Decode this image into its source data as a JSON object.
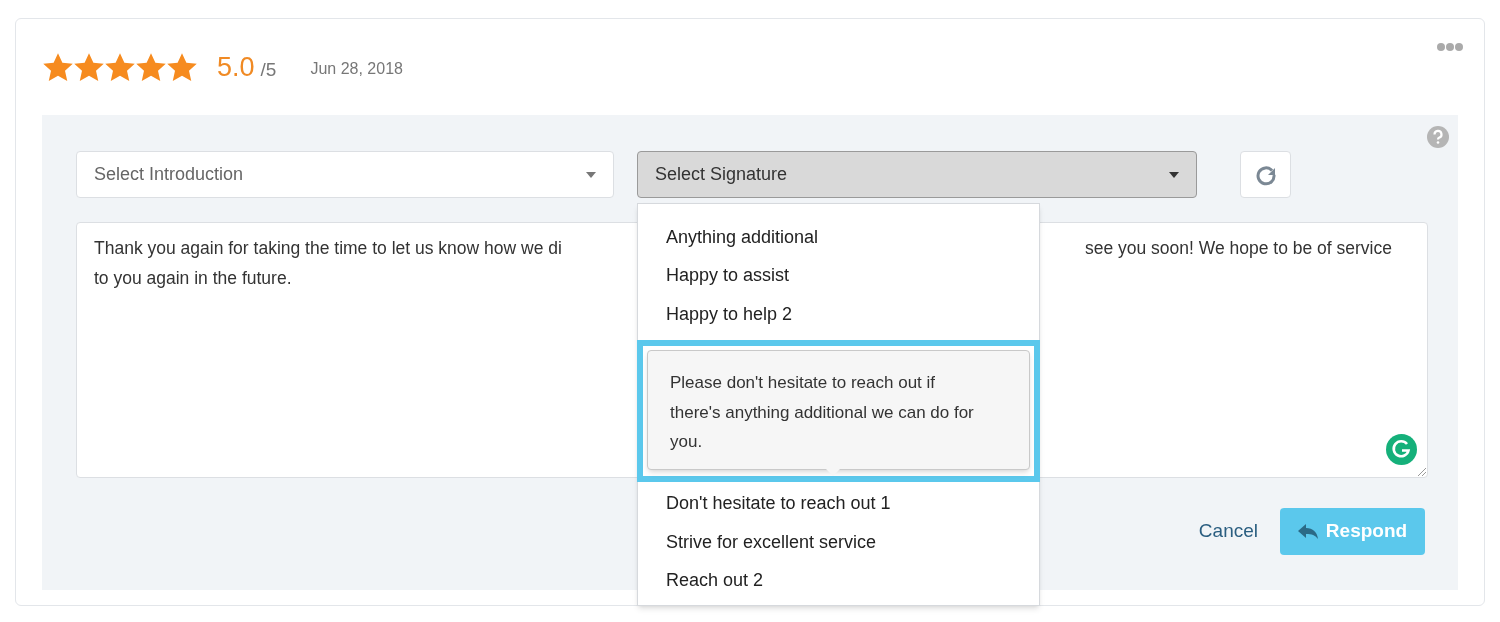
{
  "review": {
    "stars": 5,
    "score": "5.0",
    "out_of": "/5",
    "date": "Jun 28, 2018"
  },
  "introduction_select": {
    "placeholder": "Select Introduction"
  },
  "signature_select": {
    "value": "Select Signature",
    "expanded": true
  },
  "response_text": {
    "line_1_left": "Thank you again for taking the time to let us know how we di",
    "line_1_right": "see you soon! We hope to be of service",
    "line_2": "to you again in the future."
  },
  "signature_options_above_tooltip": [
    {
      "label": "Anything additional",
      "selected": false
    },
    {
      "label": "Happy to assist",
      "selected": false
    },
    {
      "label": "Happy to help 2",
      "selected": false
    }
  ],
  "signature_options_below_tooltip": [
    {
      "label": "Don't hesitate to reach out 1",
      "selected": false
    },
    {
      "label": "Strive for excellent service",
      "selected": false
    },
    {
      "label": "Reach out 2",
      "selected": false
    }
  ],
  "tooltip": {
    "text": "Please don't hesitate to reach out if there's anything additional we can do for you.",
    "highlighted": true
  },
  "buttons": {
    "cancel": "Cancel",
    "respond": "Respond"
  }
}
